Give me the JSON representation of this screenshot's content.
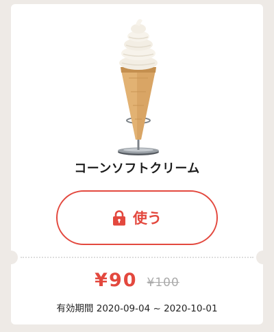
{
  "coupon": {
    "product_image": "soft-serve-cone-on-stand",
    "product_name": "コーンソフトクリーム",
    "use_button": {
      "icon": "lock-icon",
      "label": "使う"
    },
    "price": {
      "current": "¥90",
      "original": "¥100"
    },
    "validity": "有効期間 2020-09-04 ~ 2020-10-01"
  },
  "colors": {
    "accent": "#e3483e",
    "page_background": "#eeeae6",
    "card_background": "#ffffff",
    "muted_price": "#aaaaaa"
  }
}
